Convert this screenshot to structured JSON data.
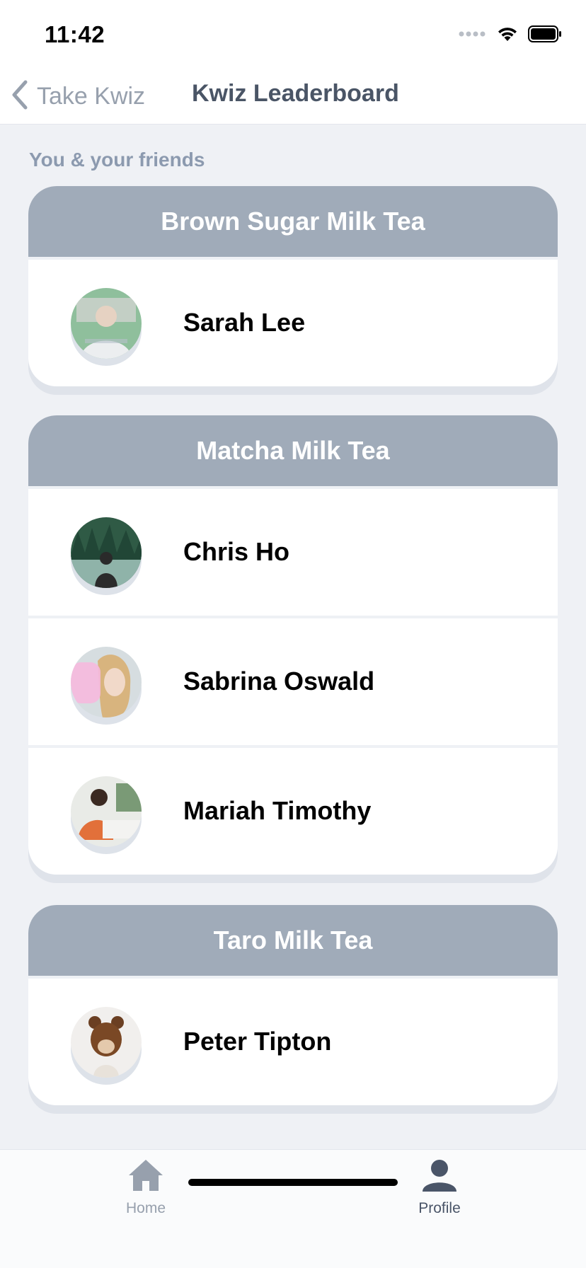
{
  "status_bar": {
    "time": "11:42",
    "icons": [
      "signal-icon",
      "wifi-icon",
      "battery-icon"
    ]
  },
  "nav": {
    "back_label": "Take Kwiz",
    "title": "Kwiz Leaderboard"
  },
  "section": {
    "label": "You & your friends"
  },
  "groups": [
    {
      "title": "Brown Sugar Milk Tea",
      "members": [
        {
          "name": "Sarah Lee"
        }
      ]
    },
    {
      "title": "Matcha Milk Tea",
      "members": [
        {
          "name": "Chris Ho"
        },
        {
          "name": "Sabrina Oswald"
        },
        {
          "name": "Mariah Timothy"
        }
      ]
    },
    {
      "title": "Taro Milk Tea",
      "members": [
        {
          "name": "Peter Tipton"
        }
      ]
    }
  ],
  "tabs": [
    {
      "label": "Home",
      "icon": "home-icon",
      "active": false
    },
    {
      "label": "Profile",
      "icon": "profile-icon",
      "active": true
    }
  ],
  "colors": {
    "background": "#eff1f5",
    "card_header": "#a0abb9",
    "tab_active": "#4a5568",
    "tab_inactive": "#97a0ad"
  }
}
